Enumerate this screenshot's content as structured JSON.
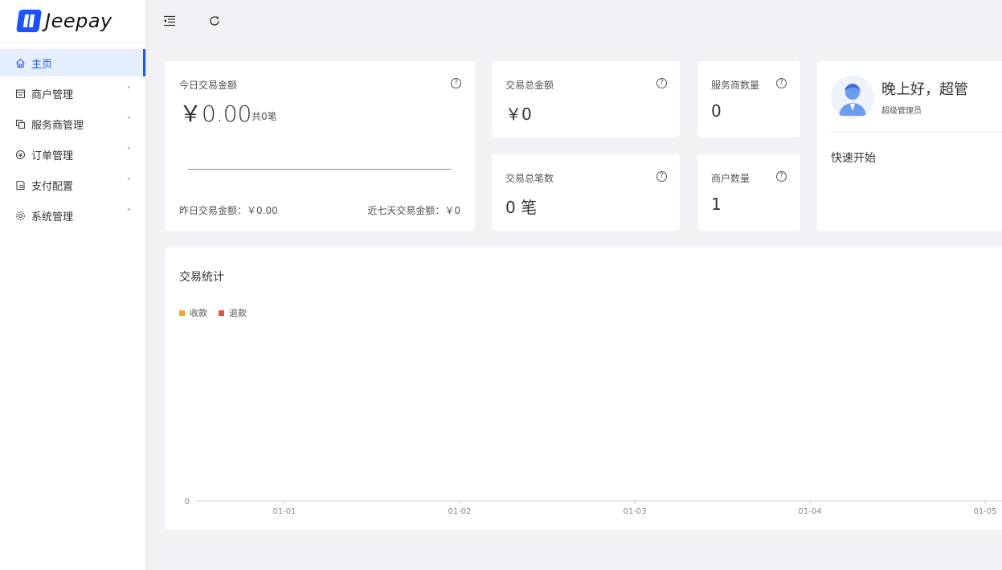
{
  "brand": {
    "name": "Jeepay",
    "color": "#1a53ff"
  },
  "sidebar": {
    "items": [
      {
        "label": "主页",
        "icon": "home-icon",
        "active": true,
        "expandable": false
      },
      {
        "label": "商户管理",
        "icon": "store-icon",
        "active": false,
        "expandable": true
      },
      {
        "label": "服务商管理",
        "icon": "copy-icon",
        "active": false,
        "expandable": true
      },
      {
        "label": "订单管理",
        "icon": "order-icon",
        "active": false,
        "expandable": true
      },
      {
        "label": "支付配置",
        "icon": "file-cog-icon",
        "active": false,
        "expandable": true
      },
      {
        "label": "系统管理",
        "icon": "gear-icon",
        "active": false,
        "expandable": true
      }
    ]
  },
  "topbar": {
    "collapse_icon": "menu-fold-icon",
    "refresh_icon": "reload-icon"
  },
  "today": {
    "title": "今日交易金额",
    "amount": "￥0.00",
    "count": "共0笔",
    "yesterday": "昨日交易金额：￥0.00",
    "week": "近七天交易金额：￥0"
  },
  "stats": {
    "total_amount": {
      "title": "交易总金额",
      "value": "￥0"
    },
    "total_count": {
      "title": "交易总笔数",
      "value": "0 笔"
    },
    "isv_count": {
      "title": "服务商数量",
      "value": "0"
    },
    "mch_count": {
      "title": "商户数量",
      "value": "1"
    }
  },
  "user": {
    "greeting": "晚上好，超管",
    "role": "超级管理员",
    "quick_start": "快速开始"
  },
  "chart": {
    "title": "交易统计",
    "legend": [
      {
        "name": "收款",
        "color": "#f7a42a"
      },
      {
        "name": "退款",
        "color": "#e8513f"
      }
    ]
  },
  "chart_data": {
    "type": "bar",
    "categories": [
      "01-01",
      "01-02",
      "01-03",
      "01-04",
      "01-05"
    ],
    "series": [
      {
        "name": "收款",
        "values": [
          0,
          0,
          0,
          0,
          0
        ]
      },
      {
        "name": "退款",
        "values": [
          0,
          0,
          0,
          0,
          0
        ]
      }
    ],
    "y_ticks": [
      "0"
    ],
    "ylim": [
      0,
      0
    ],
    "legend_position": "top-left",
    "grid": false
  }
}
